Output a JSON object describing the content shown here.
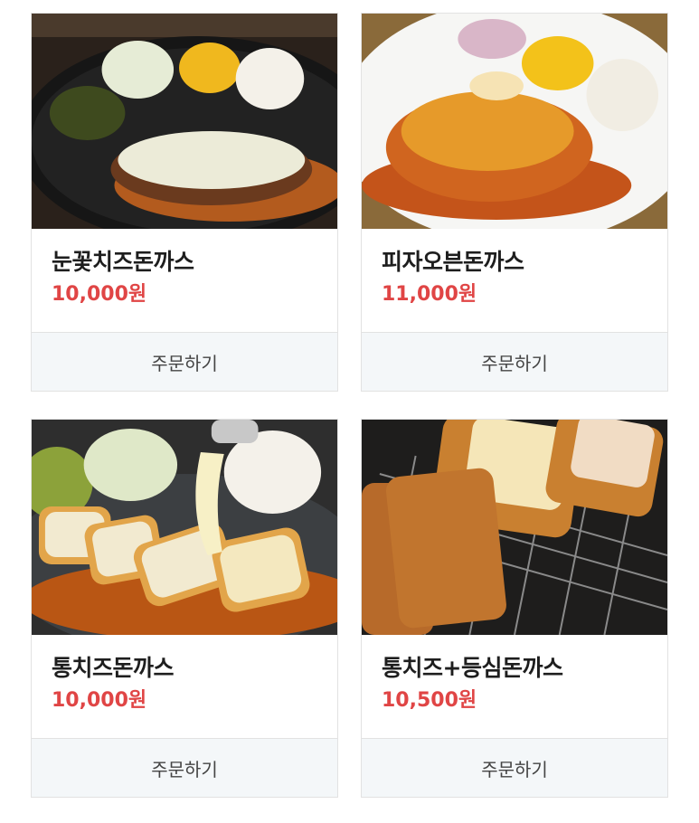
{
  "menu_items": [
    {
      "name": "눈꽃치즈돈까스",
      "price": "10,000원",
      "order_label": "주문하기"
    },
    {
      "name": "피자오븐돈까스",
      "price": "11,000원",
      "order_label": "주문하기"
    },
    {
      "name": "통치즈돈까스",
      "price": "10,000원",
      "order_label": "주문하기"
    },
    {
      "name": "통치즈+등심돈까스",
      "price": "10,500원",
      "order_label": "주문하기"
    }
  ],
  "colors": {
    "price": "#e04545",
    "order_bg": "#f4f7f9",
    "border": "#e2e2e2"
  }
}
